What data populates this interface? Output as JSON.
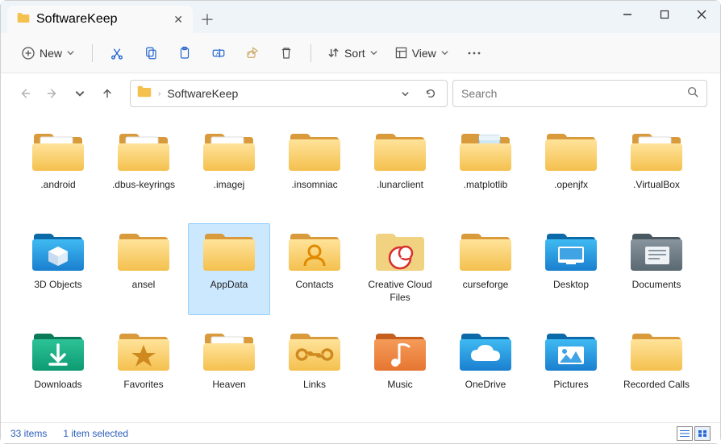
{
  "tab": {
    "title": "SoftwareKeep"
  },
  "toolbar": {
    "new_label": "New",
    "sort_label": "Sort",
    "view_label": "View"
  },
  "breadcrumb": {
    "crumb1": "SoftwareKeep"
  },
  "search": {
    "placeholder": "Search"
  },
  "folders": [
    {
      "name": ".android",
      "icon": "docfolder",
      "selected": false
    },
    {
      "name": ".dbus-keyrings",
      "icon": "docfolder",
      "selected": false
    },
    {
      "name": ".imagej",
      "icon": "docfolder",
      "selected": false
    },
    {
      "name": ".insomniac",
      "icon": "folder",
      "selected": false
    },
    {
      "name": ".lunarclient",
      "icon": "folder",
      "selected": false
    },
    {
      "name": ".matplotlib",
      "icon": "notefolder",
      "selected": false
    },
    {
      "name": ".openjfx",
      "icon": "folder",
      "selected": false
    },
    {
      "name": ".VirtualBox",
      "icon": "docfolder",
      "selected": false
    },
    {
      "name": "3D Objects",
      "icon": "3d",
      "selected": false
    },
    {
      "name": "ansel",
      "icon": "folder",
      "selected": false
    },
    {
      "name": "AppData",
      "icon": "folder",
      "selected": true
    },
    {
      "name": "Contacts",
      "icon": "contacts",
      "selected": false
    },
    {
      "name": "Creative Cloud Files",
      "icon": "ccloud",
      "selected": false
    },
    {
      "name": "curseforge",
      "icon": "folder",
      "selected": false
    },
    {
      "name": "Desktop",
      "icon": "desktop",
      "selected": false
    },
    {
      "name": "Documents",
      "icon": "documents",
      "selected": false
    },
    {
      "name": "Downloads",
      "icon": "downloads",
      "selected": false
    },
    {
      "name": "Favorites",
      "icon": "favorites",
      "selected": false
    },
    {
      "name": "Heaven",
      "icon": "docfolder",
      "selected": false
    },
    {
      "name": "Links",
      "icon": "links",
      "selected": false
    },
    {
      "name": "Music",
      "icon": "music",
      "selected": false
    },
    {
      "name": "OneDrive",
      "icon": "onedrive",
      "selected": false
    },
    {
      "name": "Pictures",
      "icon": "pictures",
      "selected": false
    },
    {
      "name": "Recorded Calls",
      "icon": "folder",
      "selected": false
    }
  ],
  "status": {
    "count": "33 items",
    "selection": "1 item selected"
  }
}
